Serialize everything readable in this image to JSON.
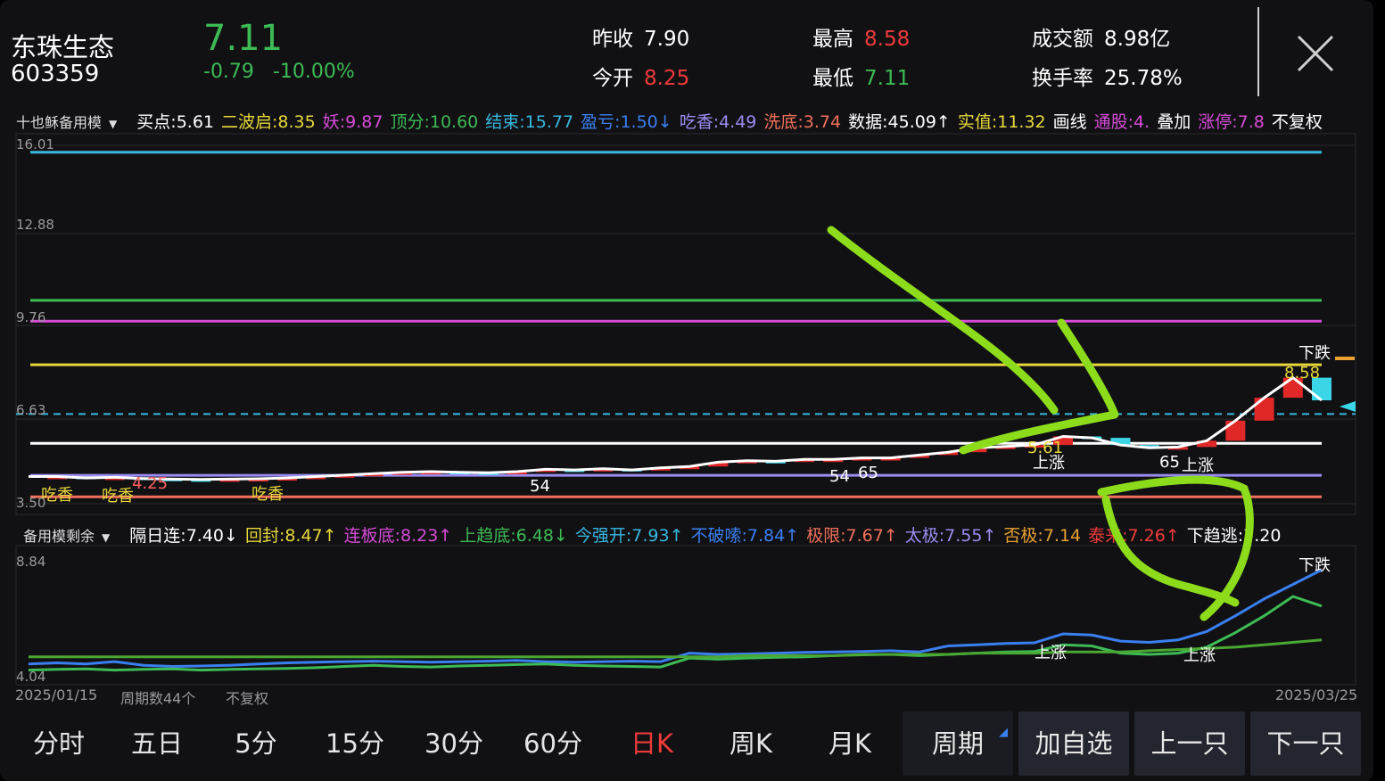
{
  "stock": {
    "name": "东珠生态",
    "code": "603359",
    "price": "7.11",
    "change": "-0.79",
    "change_pct": "-10.00%"
  },
  "stats": [
    {
      "label": "昨收",
      "value": "7.90",
      "color": "#ffffff"
    },
    {
      "label": "今开",
      "value": "8.25",
      "color": "#f03a3a"
    },
    {
      "label": "最高",
      "value": "8.58",
      "color": "#f03a3a"
    },
    {
      "label": "最低",
      "value": "7.11",
      "color": "#3dbb54"
    },
    {
      "label": "成交额",
      "value": "8.98亿",
      "color": "#ffffff"
    },
    {
      "label": "换手率",
      "value": "25.78%",
      "color": "#ffffff"
    }
  ],
  "main_indicator": {
    "name": "十也稣备用模",
    "items": [
      {
        "text": "买点:5.61",
        "color": "#ffffff"
      },
      {
        "text": "二波启:8.35",
        "color": "#e8d83a"
      },
      {
        "text": "妖:9.87",
        "color": "#d64bd6"
      },
      {
        "text": "顶分:10.60",
        "color": "#3dbb54"
      },
      {
        "text": "结束:15.77",
        "color": "#38b8e0"
      },
      {
        "text": "盈亏:1.50↓",
        "color": "#3a7ff0"
      },
      {
        "text": "吃香:4.49",
        "color": "#9a8cf0"
      },
      {
        "text": "洗底:3.74",
        "color": "#f0705a"
      },
      {
        "text": "数据:45.09↑",
        "color": "#ffffff"
      },
      {
        "text": "实值:11.32",
        "color": "#e8d83a"
      },
      {
        "text": "画线",
        "color": "#ffffff"
      },
      {
        "text": "通股:4.",
        "color": "#d64bd6"
      },
      {
        "text": "叠加",
        "color": "#ffffff"
      },
      {
        "text": "涨停:7.8",
        "color": "#d64bd6"
      },
      {
        "text": "不复权",
        "color": "#ffffff"
      }
    ]
  },
  "sub_indicator": {
    "name": "备用模剩余",
    "items": [
      {
        "text": "隔日连:7.40↓",
        "color": "#ffffff"
      },
      {
        "text": "回封:8.47↑",
        "color": "#e8d83a"
      },
      {
        "text": "连板底:8.23↑",
        "color": "#d64bd6"
      },
      {
        "text": "上趋底:6.48↓",
        "color": "#3dbb54"
      },
      {
        "text": "今强开:7.93↑",
        "color": "#38b8e0"
      },
      {
        "text": "不破嗦:7.84↑",
        "color": "#3a7ff0"
      },
      {
        "text": "极限:7.67↑",
        "color": "#f0705a"
      },
      {
        "text": "太极:7.55↑",
        "color": "#9a8cf0"
      },
      {
        "text": "否极:7.14",
        "color": "#e8a030"
      },
      {
        "text": "泰来:7.26↑",
        "color": "#f03a3a"
      },
      {
        "text": "下趋逃:7.20",
        "color": "#ffffff"
      }
    ]
  },
  "axes": {
    "main_ticks": [
      "16.01",
      "12.88",
      "9.76",
      "6.63",
      "3.50"
    ],
    "sub_ticks": [
      "8.84",
      "4.04"
    ],
    "date_start": "2025/01/15",
    "date_end": "2025/03/25",
    "period_count": "周期数44个",
    "adjust": "不复权"
  },
  "annotations": [
    "上涨",
    "上涨",
    "下跌",
    "下跌",
    "吃香",
    "吃香",
    "吃香",
    "上涨",
    "上涨",
    "54",
    "54",
    "65",
    "65",
    "8.58",
    "5.61",
    "4.25"
  ],
  "tabs": [
    {
      "label": "分时",
      "active": false
    },
    {
      "label": "五日",
      "active": false
    },
    {
      "label": "5分",
      "active": false
    },
    {
      "label": "15分",
      "active": false
    },
    {
      "label": "30分",
      "active": false
    },
    {
      "label": "60分",
      "active": false
    },
    {
      "label": "日K",
      "active": true
    },
    {
      "label": "周K",
      "active": false
    },
    {
      "label": "月K",
      "active": false
    },
    {
      "label": "周期",
      "active": false
    }
  ],
  "buttons": {
    "add_watch": "加自选",
    "prev": "上一只",
    "next": "下一只"
  },
  "chart_data": {
    "type": "candlestick",
    "y_range": [
      3.5,
      16.01
    ],
    "horizontal_levels": [
      {
        "value": 15.77,
        "color": "#38b8e0"
      },
      {
        "value": 10.6,
        "color": "#3dbb54"
      },
      {
        "value": 9.87,
        "color": "#d64bd6"
      },
      {
        "value": 8.35,
        "color": "#e8d83a"
      },
      {
        "value": 6.63,
        "color": "#38b8e0"
      },
      {
        "value": 5.61,
        "color": "#ffffff"
      },
      {
        "value": 4.49,
        "color": "#9a8cf0"
      },
      {
        "value": 3.74,
        "color": "#f0705a"
      }
    ],
    "close_line": [
      4.45,
      4.45,
      4.4,
      4.42,
      4.38,
      4.36,
      4.35,
      4.36,
      4.37,
      4.4,
      4.45,
      4.5,
      4.55,
      4.6,
      4.62,
      4.6,
      4.58,
      4.62,
      4.7,
      4.68,
      4.72,
      4.68,
      4.75,
      4.8,
      4.95,
      5.0,
      4.98,
      5.05,
      5.05,
      5.1,
      5.1,
      5.2,
      5.3,
      5.45,
      5.5,
      5.55,
      5.85,
      5.8,
      5.55,
      5.45,
      5.48,
      5.7,
      6.4,
      7.2,
      7.9,
      7.11
    ],
    "sub_range": [
      4.04,
      8.84
    ],
    "sub_series": [
      {
        "color": "#3a7ff0",
        "values": [
          4.6,
          4.65,
          4.6,
          4.7,
          4.55,
          4.5,
          4.52,
          4.55,
          4.6,
          4.65,
          4.68,
          4.7,
          4.72,
          4.7,
          4.68,
          4.7,
          4.72,
          4.75,
          4.7,
          4.68,
          4.7,
          4.72,
          4.7,
          5.05,
          5.0,
          5.02,
          5.05,
          5.08,
          5.1,
          5.12,
          5.15,
          5.1,
          5.35,
          5.4,
          5.45,
          5.48,
          5.85,
          5.8,
          5.55,
          5.5,
          5.6,
          5.95,
          6.6,
          7.3,
          7.9,
          8.5
        ]
      },
      {
        "color": "#3dbb54",
        "values": [
          4.35,
          4.38,
          4.4,
          4.35,
          4.38,
          4.4,
          4.35,
          4.38,
          4.4,
          4.42,
          4.45,
          4.5,
          4.55,
          4.5,
          4.48,
          4.52,
          4.55,
          4.58,
          4.6,
          4.55,
          4.52,
          4.5,
          4.48,
          4.85,
          4.8,
          4.85,
          4.88,
          4.9,
          4.95,
          4.98,
          5.0,
          4.95,
          5.0,
          5.05,
          5.1,
          5.12,
          5.4,
          5.35,
          5.05,
          5.0,
          5.05,
          5.3,
          5.9,
          6.6,
          7.4,
          7.0
        ]
      },
      {
        "color": "#4aa832",
        "values": [
          4.9,
          4.9,
          4.9,
          4.9,
          4.9,
          4.9,
          4.9,
          4.9,
          4.9,
          4.9,
          4.9,
          4.9,
          4.9,
          4.9,
          4.9,
          4.9,
          4.9,
          4.9,
          4.9,
          4.9,
          4.9,
          4.9,
          4.9,
          4.9,
          4.9,
          4.95,
          4.95,
          4.95,
          4.95,
          5.0,
          5.0,
          5.0,
          5.0,
          5.05,
          5.05,
          5.05,
          5.1,
          5.1,
          5.1,
          5.15,
          5.2,
          5.25,
          5.3,
          5.4,
          5.5,
          5.6
        ]
      }
    ]
  }
}
